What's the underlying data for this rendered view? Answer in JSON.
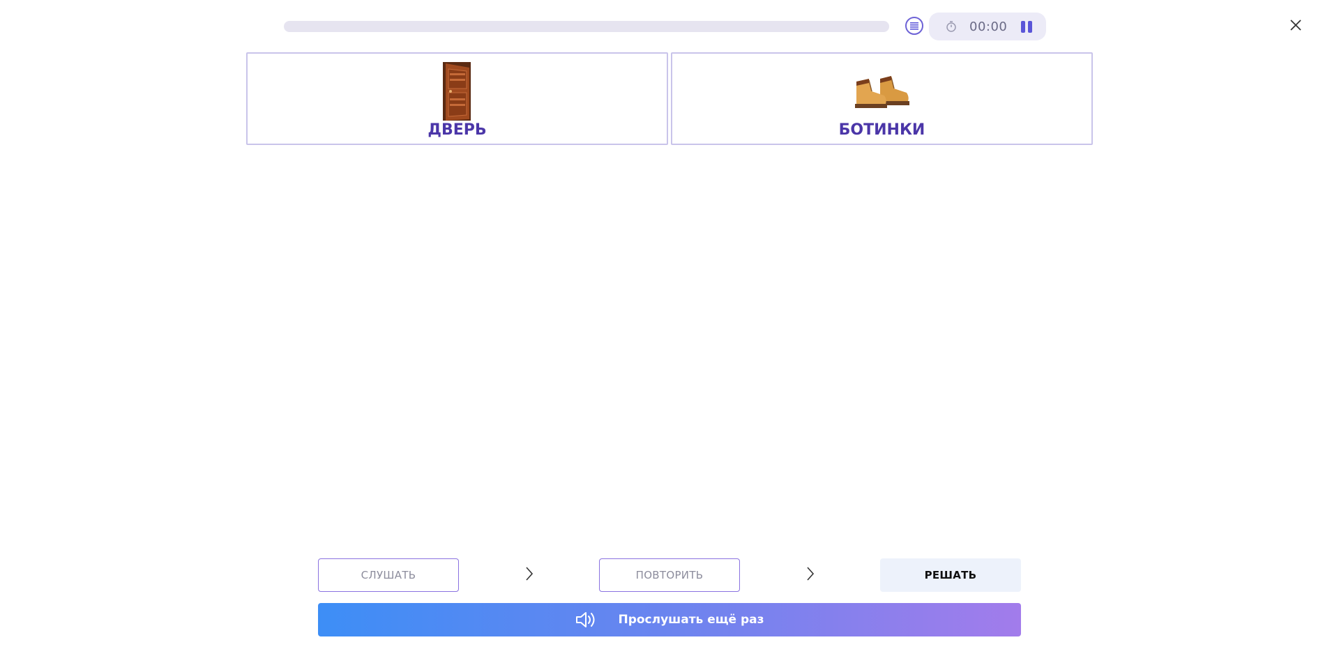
{
  "header": {
    "progress_fraction": 0,
    "timer": "00:00"
  },
  "cards": [
    {
      "label": "ДВЕРЬ",
      "icon": "door-icon"
    },
    {
      "label": "БОТИНКИ",
      "icon": "boots-icon"
    }
  ],
  "steps": {
    "listen": "СЛУШАТЬ",
    "repeat": "ПОВТОРИТЬ",
    "solve": "РЕШАТЬ"
  },
  "listen_again": {
    "label": "Прослушать ещё раз",
    "icon": "speaker-icon"
  },
  "colors": {
    "accent": "#5a55d8",
    "card_label": "#4b36a8",
    "gradient_start": "#3d8ef6",
    "gradient_end": "#a27ceb"
  }
}
